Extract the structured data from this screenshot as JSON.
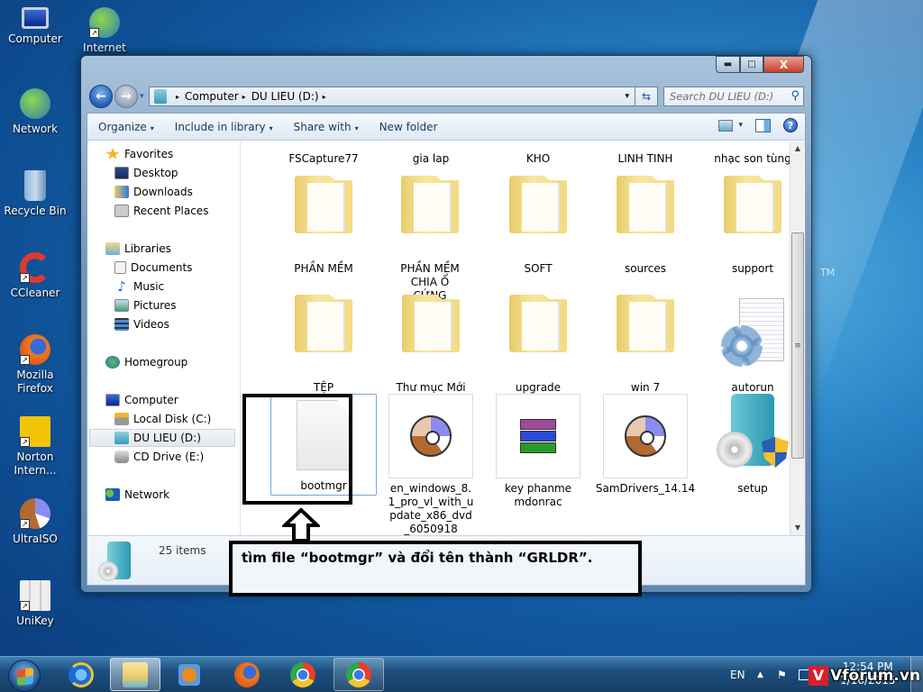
{
  "desktop": {
    "icons": [
      {
        "label": "Computer",
        "icon": "computer-icon"
      },
      {
        "label": "Internet",
        "icon": "internet-download-manager-icon"
      },
      {
        "label": "Network",
        "icon": "network-icon"
      },
      {
        "label": "Recycle Bin",
        "icon": "recycle-bin-icon"
      },
      {
        "label": "CCleaner",
        "icon": "ccleaner-icon"
      },
      {
        "label": "Mozilla Firefox",
        "icon": "firefox-icon"
      },
      {
        "label": "Norton Intern...",
        "icon": "norton-icon"
      },
      {
        "label": "UltraISO",
        "icon": "ultraiso-icon"
      },
      {
        "label": "UniKey",
        "icon": "unikey-icon"
      }
    ],
    "wallpaper_mark": "TM"
  },
  "window": {
    "caption_buttons": {
      "minimize": "▬",
      "maximize": "□",
      "close": "X"
    },
    "nav": {
      "back": "←",
      "forward": "→",
      "history": "▾"
    },
    "address": {
      "crumbs": [
        "Computer",
        "DU LIEU (D:)"
      ],
      "separator": "▸",
      "dropdown": "▾"
    },
    "refresh": "⇆",
    "search": {
      "placeholder": "Search DU LIEU (D:)",
      "icon": "⚲"
    },
    "toolbar": {
      "organize": "Organize",
      "include_in_library": "Include in library",
      "share_with": "Share with",
      "new_folder": "New folder",
      "caret": "▾",
      "help": "?"
    },
    "navpane": {
      "favorites": "Favorites",
      "favorites_items": [
        "Desktop",
        "Downloads",
        "Recent Places"
      ],
      "libraries": "Libraries",
      "libraries_items": [
        "Documents",
        "Music",
        "Pictures",
        "Videos"
      ],
      "homegroup": "Homegroup",
      "computer": "Computer",
      "computer_items": [
        "Local Disk (C:)",
        "DU LIEU (D:)",
        "CD Drive (E:)"
      ],
      "selected": "DU LIEU (D:)",
      "network": "Network"
    },
    "files": {
      "row0": [
        "FSCapture77",
        "gia lap",
        "KHO",
        "LINH TINH",
        "nhạc son tùng"
      ],
      "row1": [
        "PHẦN MỀM",
        "PHẦN MỀM CHIA Ổ CỨNG",
        "SOFT",
        "sources",
        "support"
      ],
      "row2": [
        "TỆP",
        "Thư mục Mới",
        "upgrade",
        "win 7",
        "autorun"
      ],
      "row3": [
        "bootmgr",
        "en_windows_8.1_pro_vl_with_update_x86_dvd_6050918",
        "key phanmemdonrac",
        "SamDrivers_14.14",
        "setup"
      ]
    },
    "scrollbar": {
      "up": "▲",
      "down": "▼",
      "grip": "≡",
      "position_fraction": 0.55
    },
    "details": {
      "item_count": "25 items"
    }
  },
  "annotation": {
    "text": "tìm file “bootmgr” và đổi tên thành “GRLDR”.",
    "highlighted_file": "bootmgr"
  },
  "taskbar": {
    "apps": [
      "internet-explorer",
      "windows-explorer",
      "windows-media-player",
      "firefox",
      "chrome",
      "chrome"
    ],
    "tray": {
      "language": "EN",
      "show_hidden": "▲",
      "action_center": "⚑",
      "time": "12:54 PM",
      "date": "1/16/2015"
    },
    "watermark": {
      "mark": "V",
      "text": "Vforum.vn"
    }
  }
}
